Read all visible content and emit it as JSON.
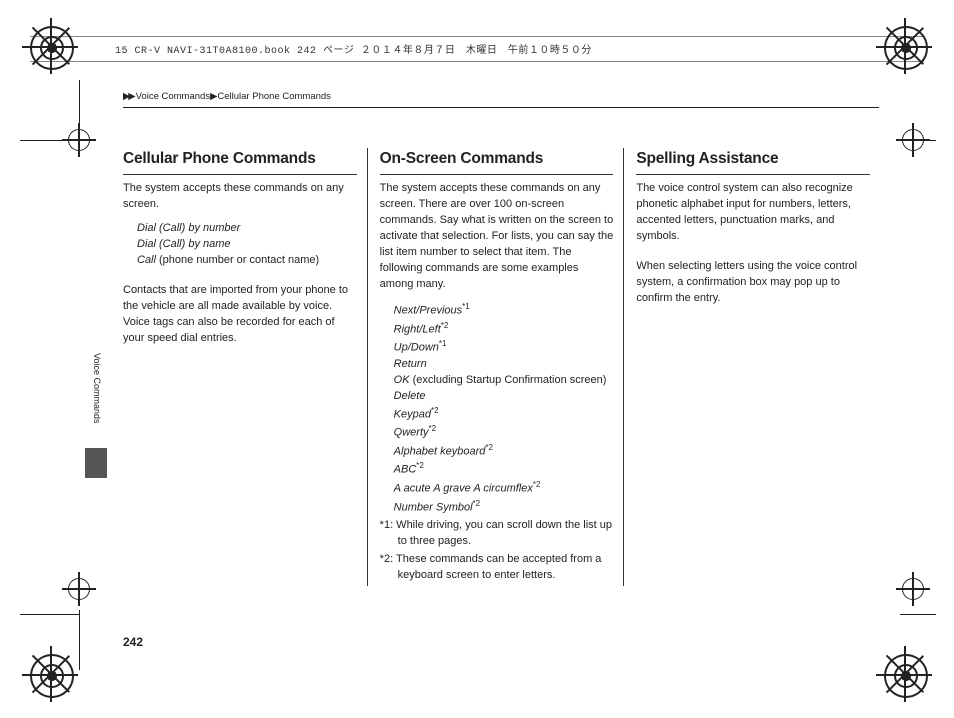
{
  "print_header": "15 CR-V NAVI-31T0A8100.book  242 ページ  ２０１４年８月７日　木曜日　午前１０時５０分",
  "breadcrumb": {
    "arrows": "▶▶",
    "level1": "Voice Commands",
    "sep": "▶",
    "level2": "Cellular Phone Commands"
  },
  "side_tab": "Voice Commands",
  "page_number": "242",
  "columns": {
    "c1": {
      "title": "Cellular Phone Commands",
      "p1": "The system accepts these commands on any screen.",
      "cmds": [
        "Dial (Call) by number",
        "Dial (Call) by name"
      ],
      "cmd_call_prefix": "Call",
      "cmd_call_rest": " (phone number or contact name)",
      "p2": "Contacts that are imported from your phone to the vehicle are all made available by voice. Voice tags can also be recorded for each of your speed dial entries."
    },
    "c2": {
      "title": "On-Screen Commands",
      "p1": "The system accepts these commands on any screen. There are over 100 on-screen commands. Say what is written on the screen to activate that selection. For lists, you can say the list item number to select that item. The following commands are some examples among many.",
      "items": [
        {
          "text": "Next/Previous",
          "sup": "*1"
        },
        {
          "text": "Right/Left",
          "sup": "*2"
        },
        {
          "text": "Up/Down",
          "sup": "*1"
        },
        {
          "text": "Return",
          "sup": ""
        },
        {
          "text_pre": "OK",
          "text_rest": " (excluding Startup Confirmation screen)"
        },
        {
          "text": "Delete",
          "sup": ""
        },
        {
          "text": "Keypad",
          "sup": "*2"
        },
        {
          "text": "Qwerty",
          "sup": "*2"
        },
        {
          "text": "Alphabet keyboard",
          "sup": "*2"
        },
        {
          "text": "ABC",
          "sup": "*2"
        },
        {
          "text": "A acute A grave A circumflex",
          "sup": "*2"
        },
        {
          "text": "Number Symbol",
          "sup": "*2"
        }
      ],
      "fn1": "*1: While driving, you can scroll down the list up to three pages.",
      "fn2": "*2: These commands can be accepted from a keyboard screen to enter letters."
    },
    "c3": {
      "title": "Spelling Assistance",
      "p1": "The voice control system can also recognize phonetic alphabet input for numbers, letters, accented letters, punctuation marks, and symbols.",
      "p2": "When selecting letters using the voice control system, a confirmation box may pop up to confirm the entry."
    }
  }
}
